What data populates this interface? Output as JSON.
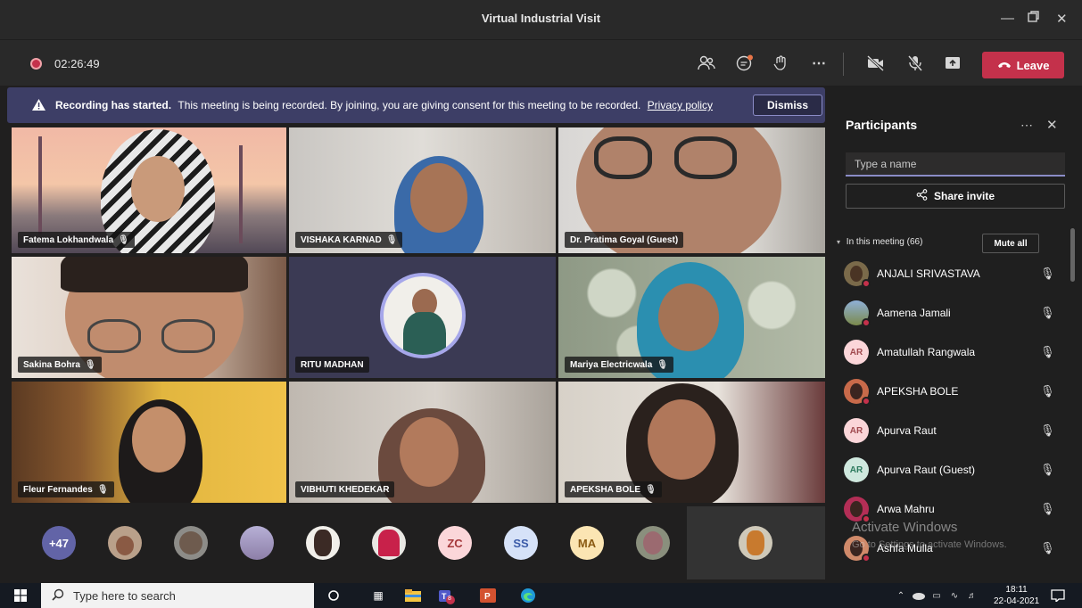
{
  "window": {
    "title": "Virtual Industrial Visit"
  },
  "toolbar": {
    "timer": "02:26:49",
    "leave_label": "Leave"
  },
  "banner": {
    "bold": "Recording has started.",
    "text": "This meeting is being recorded. By joining, you are giving consent for this meeting to be recorded.",
    "link": "Privacy policy",
    "dismiss_label": "Dismiss"
  },
  "tiles": [
    {
      "name": "Fatema Lokhandwala",
      "muted": true
    },
    {
      "name": "VISHAKA KARNAD",
      "muted": true
    },
    {
      "name": "Dr. Pratima Goyal (Guest)",
      "muted": false
    },
    {
      "name": "Sakina Bohra",
      "muted": true
    },
    {
      "name": "RITU MADHAN",
      "muted": false
    },
    {
      "name": "Mariya Electricwala",
      "muted": true
    },
    {
      "name": "Fleur Fernandes",
      "muted": true
    },
    {
      "name": "VIBHUTI KHEDEKAR",
      "muted": false
    },
    {
      "name": "APEKSHA BOLE",
      "muted": true
    }
  ],
  "strip": {
    "overflow": "+47",
    "initials": [
      "ZC",
      "SS",
      "MA"
    ]
  },
  "panel": {
    "title": "Participants",
    "search_placeholder": "Type a name",
    "share_label": "Share invite",
    "section_label": "In this meeting (66)",
    "mute_all_label": "Mute all",
    "participants": [
      {
        "name": "ANJALI SRIVASTAVA",
        "initials": ""
      },
      {
        "name": "Aamena Jamali",
        "initials": ""
      },
      {
        "name": "Amatullah Rangwala",
        "initials": "AR"
      },
      {
        "name": "APEKSHA BOLE",
        "initials": ""
      },
      {
        "name": "Apurva Raut",
        "initials": "AR"
      },
      {
        "name": "Apurva Raut (Guest)",
        "initials": "AR"
      },
      {
        "name": "Arwa Mahru",
        "initials": ""
      },
      {
        "name": "Ashfa Mulla",
        "initials": ""
      }
    ]
  },
  "watermark": {
    "line1": "Activate Windows",
    "line2": "Go to Settings to activate Windows."
  },
  "taskbar": {
    "search_placeholder": "Type here to search",
    "time": "18:11",
    "date": "22-04-2021",
    "teams_badge": "8"
  }
}
